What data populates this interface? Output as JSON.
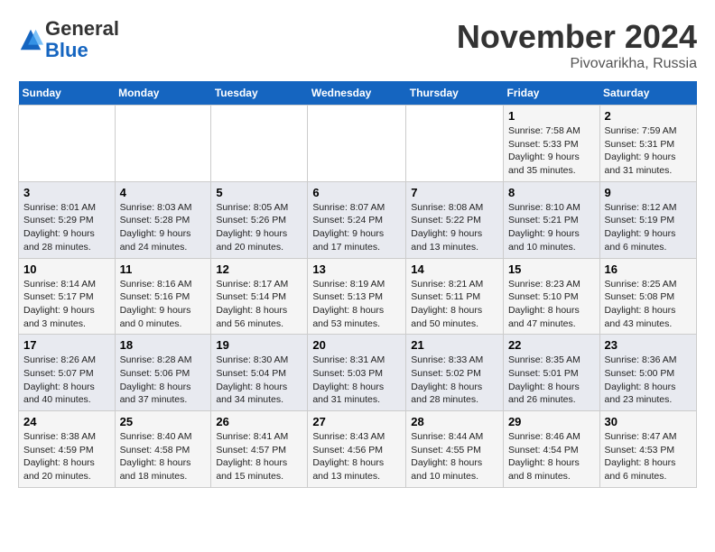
{
  "logo": {
    "general": "General",
    "blue": "Blue"
  },
  "header": {
    "month": "November 2024",
    "location": "Pivovarikha, Russia"
  },
  "weekdays": [
    "Sunday",
    "Monday",
    "Tuesday",
    "Wednesday",
    "Thursday",
    "Friday",
    "Saturday"
  ],
  "weeks": [
    [
      {
        "day": "",
        "details": ""
      },
      {
        "day": "",
        "details": ""
      },
      {
        "day": "",
        "details": ""
      },
      {
        "day": "",
        "details": ""
      },
      {
        "day": "",
        "details": ""
      },
      {
        "day": "1",
        "details": "Sunrise: 7:58 AM\nSunset: 5:33 PM\nDaylight: 9 hours\nand 35 minutes."
      },
      {
        "day": "2",
        "details": "Sunrise: 7:59 AM\nSunset: 5:31 PM\nDaylight: 9 hours\nand 31 minutes."
      }
    ],
    [
      {
        "day": "3",
        "details": "Sunrise: 8:01 AM\nSunset: 5:29 PM\nDaylight: 9 hours\nand 28 minutes."
      },
      {
        "day": "4",
        "details": "Sunrise: 8:03 AM\nSunset: 5:28 PM\nDaylight: 9 hours\nand 24 minutes."
      },
      {
        "day": "5",
        "details": "Sunrise: 8:05 AM\nSunset: 5:26 PM\nDaylight: 9 hours\nand 20 minutes."
      },
      {
        "day": "6",
        "details": "Sunrise: 8:07 AM\nSunset: 5:24 PM\nDaylight: 9 hours\nand 17 minutes."
      },
      {
        "day": "7",
        "details": "Sunrise: 8:08 AM\nSunset: 5:22 PM\nDaylight: 9 hours\nand 13 minutes."
      },
      {
        "day": "8",
        "details": "Sunrise: 8:10 AM\nSunset: 5:21 PM\nDaylight: 9 hours\nand 10 minutes."
      },
      {
        "day": "9",
        "details": "Sunrise: 8:12 AM\nSunset: 5:19 PM\nDaylight: 9 hours\nand 6 minutes."
      }
    ],
    [
      {
        "day": "10",
        "details": "Sunrise: 8:14 AM\nSunset: 5:17 PM\nDaylight: 9 hours\nand 3 minutes."
      },
      {
        "day": "11",
        "details": "Sunrise: 8:16 AM\nSunset: 5:16 PM\nDaylight: 9 hours\nand 0 minutes."
      },
      {
        "day": "12",
        "details": "Sunrise: 8:17 AM\nSunset: 5:14 PM\nDaylight: 8 hours\nand 56 minutes."
      },
      {
        "day": "13",
        "details": "Sunrise: 8:19 AM\nSunset: 5:13 PM\nDaylight: 8 hours\nand 53 minutes."
      },
      {
        "day": "14",
        "details": "Sunrise: 8:21 AM\nSunset: 5:11 PM\nDaylight: 8 hours\nand 50 minutes."
      },
      {
        "day": "15",
        "details": "Sunrise: 8:23 AM\nSunset: 5:10 PM\nDaylight: 8 hours\nand 47 minutes."
      },
      {
        "day": "16",
        "details": "Sunrise: 8:25 AM\nSunset: 5:08 PM\nDaylight: 8 hours\nand 43 minutes."
      }
    ],
    [
      {
        "day": "17",
        "details": "Sunrise: 8:26 AM\nSunset: 5:07 PM\nDaylight: 8 hours\nand 40 minutes."
      },
      {
        "day": "18",
        "details": "Sunrise: 8:28 AM\nSunset: 5:06 PM\nDaylight: 8 hours\nand 37 minutes."
      },
      {
        "day": "19",
        "details": "Sunrise: 8:30 AM\nSunset: 5:04 PM\nDaylight: 8 hours\nand 34 minutes."
      },
      {
        "day": "20",
        "details": "Sunrise: 8:31 AM\nSunset: 5:03 PM\nDaylight: 8 hours\nand 31 minutes."
      },
      {
        "day": "21",
        "details": "Sunrise: 8:33 AM\nSunset: 5:02 PM\nDaylight: 8 hours\nand 28 minutes."
      },
      {
        "day": "22",
        "details": "Sunrise: 8:35 AM\nSunset: 5:01 PM\nDaylight: 8 hours\nand 26 minutes."
      },
      {
        "day": "23",
        "details": "Sunrise: 8:36 AM\nSunset: 5:00 PM\nDaylight: 8 hours\nand 23 minutes."
      }
    ],
    [
      {
        "day": "24",
        "details": "Sunrise: 8:38 AM\nSunset: 4:59 PM\nDaylight: 8 hours\nand 20 minutes."
      },
      {
        "day": "25",
        "details": "Sunrise: 8:40 AM\nSunset: 4:58 PM\nDaylight: 8 hours\nand 18 minutes."
      },
      {
        "day": "26",
        "details": "Sunrise: 8:41 AM\nSunset: 4:57 PM\nDaylight: 8 hours\nand 15 minutes."
      },
      {
        "day": "27",
        "details": "Sunrise: 8:43 AM\nSunset: 4:56 PM\nDaylight: 8 hours\nand 13 minutes."
      },
      {
        "day": "28",
        "details": "Sunrise: 8:44 AM\nSunset: 4:55 PM\nDaylight: 8 hours\nand 10 minutes."
      },
      {
        "day": "29",
        "details": "Sunrise: 8:46 AM\nSunset: 4:54 PM\nDaylight: 8 hours\nand 8 minutes."
      },
      {
        "day": "30",
        "details": "Sunrise: 8:47 AM\nSunset: 4:53 PM\nDaylight: 8 hours\nand 6 minutes."
      }
    ]
  ]
}
